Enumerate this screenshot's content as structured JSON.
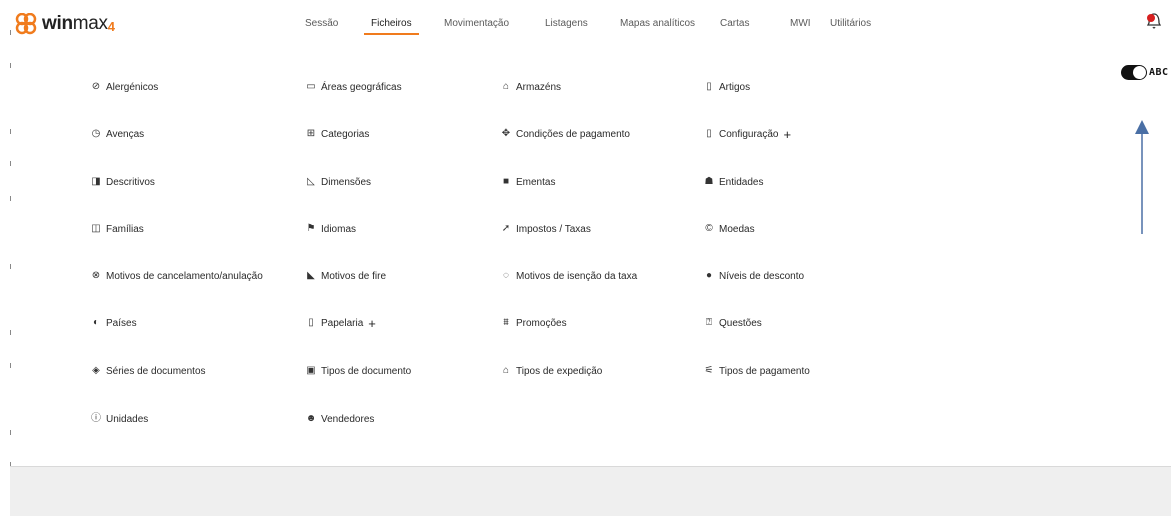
{
  "app": {
    "name_bold": "win",
    "name_light": "max",
    "name_suffix": "4"
  },
  "nav": [
    {
      "label": "Sessão",
      "active": false
    },
    {
      "label": "Ficheiros",
      "active": true
    },
    {
      "label": "Movimentação",
      "active": false
    },
    {
      "label": "Listagens",
      "active": false
    },
    {
      "label": "Mapas analíticos",
      "active": false
    },
    {
      "label": "Cartas",
      "active": false
    },
    {
      "label": "MWI",
      "active": false
    },
    {
      "label": "Utilitários",
      "active": false
    }
  ],
  "toggle": {
    "label": "ABC",
    "on": true
  },
  "colors": {
    "accent": "#f07b1d",
    "arrow": "#4a6fa5",
    "bell": "#d71f1f"
  },
  "items": [
    {
      "label": "Alergénicos",
      "icon": "ban-icon",
      "plus": false
    },
    {
      "label": "Áreas geográficas",
      "icon": "map-icon",
      "plus": false
    },
    {
      "label": "Armazéns",
      "icon": "warehouse-icon",
      "plus": false
    },
    {
      "label": "Artigos",
      "icon": "document-icon",
      "plus": false
    },
    {
      "label": "Avenças",
      "icon": "clock-icon",
      "plus": false
    },
    {
      "label": "Categorias",
      "icon": "categories-icon",
      "plus": false
    },
    {
      "label": "Condições de pagamento",
      "icon": "handshake-icon",
      "plus": false
    },
    {
      "label": "Configuração",
      "icon": "file-icon",
      "plus": true
    },
    {
      "label": "Descritivos",
      "icon": "book-icon",
      "plus": false
    },
    {
      "label": "Dimensões",
      "icon": "triangle-ruler-icon",
      "plus": false
    },
    {
      "label": "Ementas",
      "icon": "menu-book-icon",
      "plus": false
    },
    {
      "label": "Entidades",
      "icon": "people-icon",
      "plus": false
    },
    {
      "label": "Famílias",
      "icon": "folders-icon",
      "plus": false
    },
    {
      "label": "Idiomas",
      "icon": "flag-icon",
      "plus": false
    },
    {
      "label": "Impostos / Taxas",
      "icon": "gavel-icon",
      "plus": false
    },
    {
      "label": "Moedas",
      "icon": "coin-icon",
      "plus": false
    },
    {
      "label": "Motivos de cancelamento/anulação",
      "icon": "cancel-reason-icon",
      "plus": false
    },
    {
      "label": "Motivos de fire",
      "icon": "fire-icon",
      "plus": false
    },
    {
      "label": "Motivos de isenção da taxa",
      "icon": "search-icon",
      "plus": false
    },
    {
      "label": "Níveis de desconto",
      "icon": "discount-icon",
      "plus": false
    },
    {
      "label": "Países",
      "icon": "globe-icon",
      "plus": false
    },
    {
      "label": "Papelaria",
      "icon": "file-icon",
      "plus": true
    },
    {
      "label": "Promoções",
      "icon": "promotion-icon",
      "plus": false
    },
    {
      "label": "Questões",
      "icon": "question-icon",
      "plus": false
    },
    {
      "label": "Séries de documentos",
      "icon": "stack-icon",
      "plus": false
    },
    {
      "label": "Tipos de documento",
      "icon": "document-type-icon",
      "plus": false
    },
    {
      "label": "Tipos de expedição",
      "icon": "shipping-icon",
      "plus": false
    },
    {
      "label": "Tipos de pagamento",
      "icon": "payment-icon",
      "plus": false
    },
    {
      "label": "Unidades",
      "icon": "info-icon",
      "plus": false
    },
    {
      "label": "Vendedores",
      "icon": "salespeople-icon",
      "plus": false
    }
  ]
}
